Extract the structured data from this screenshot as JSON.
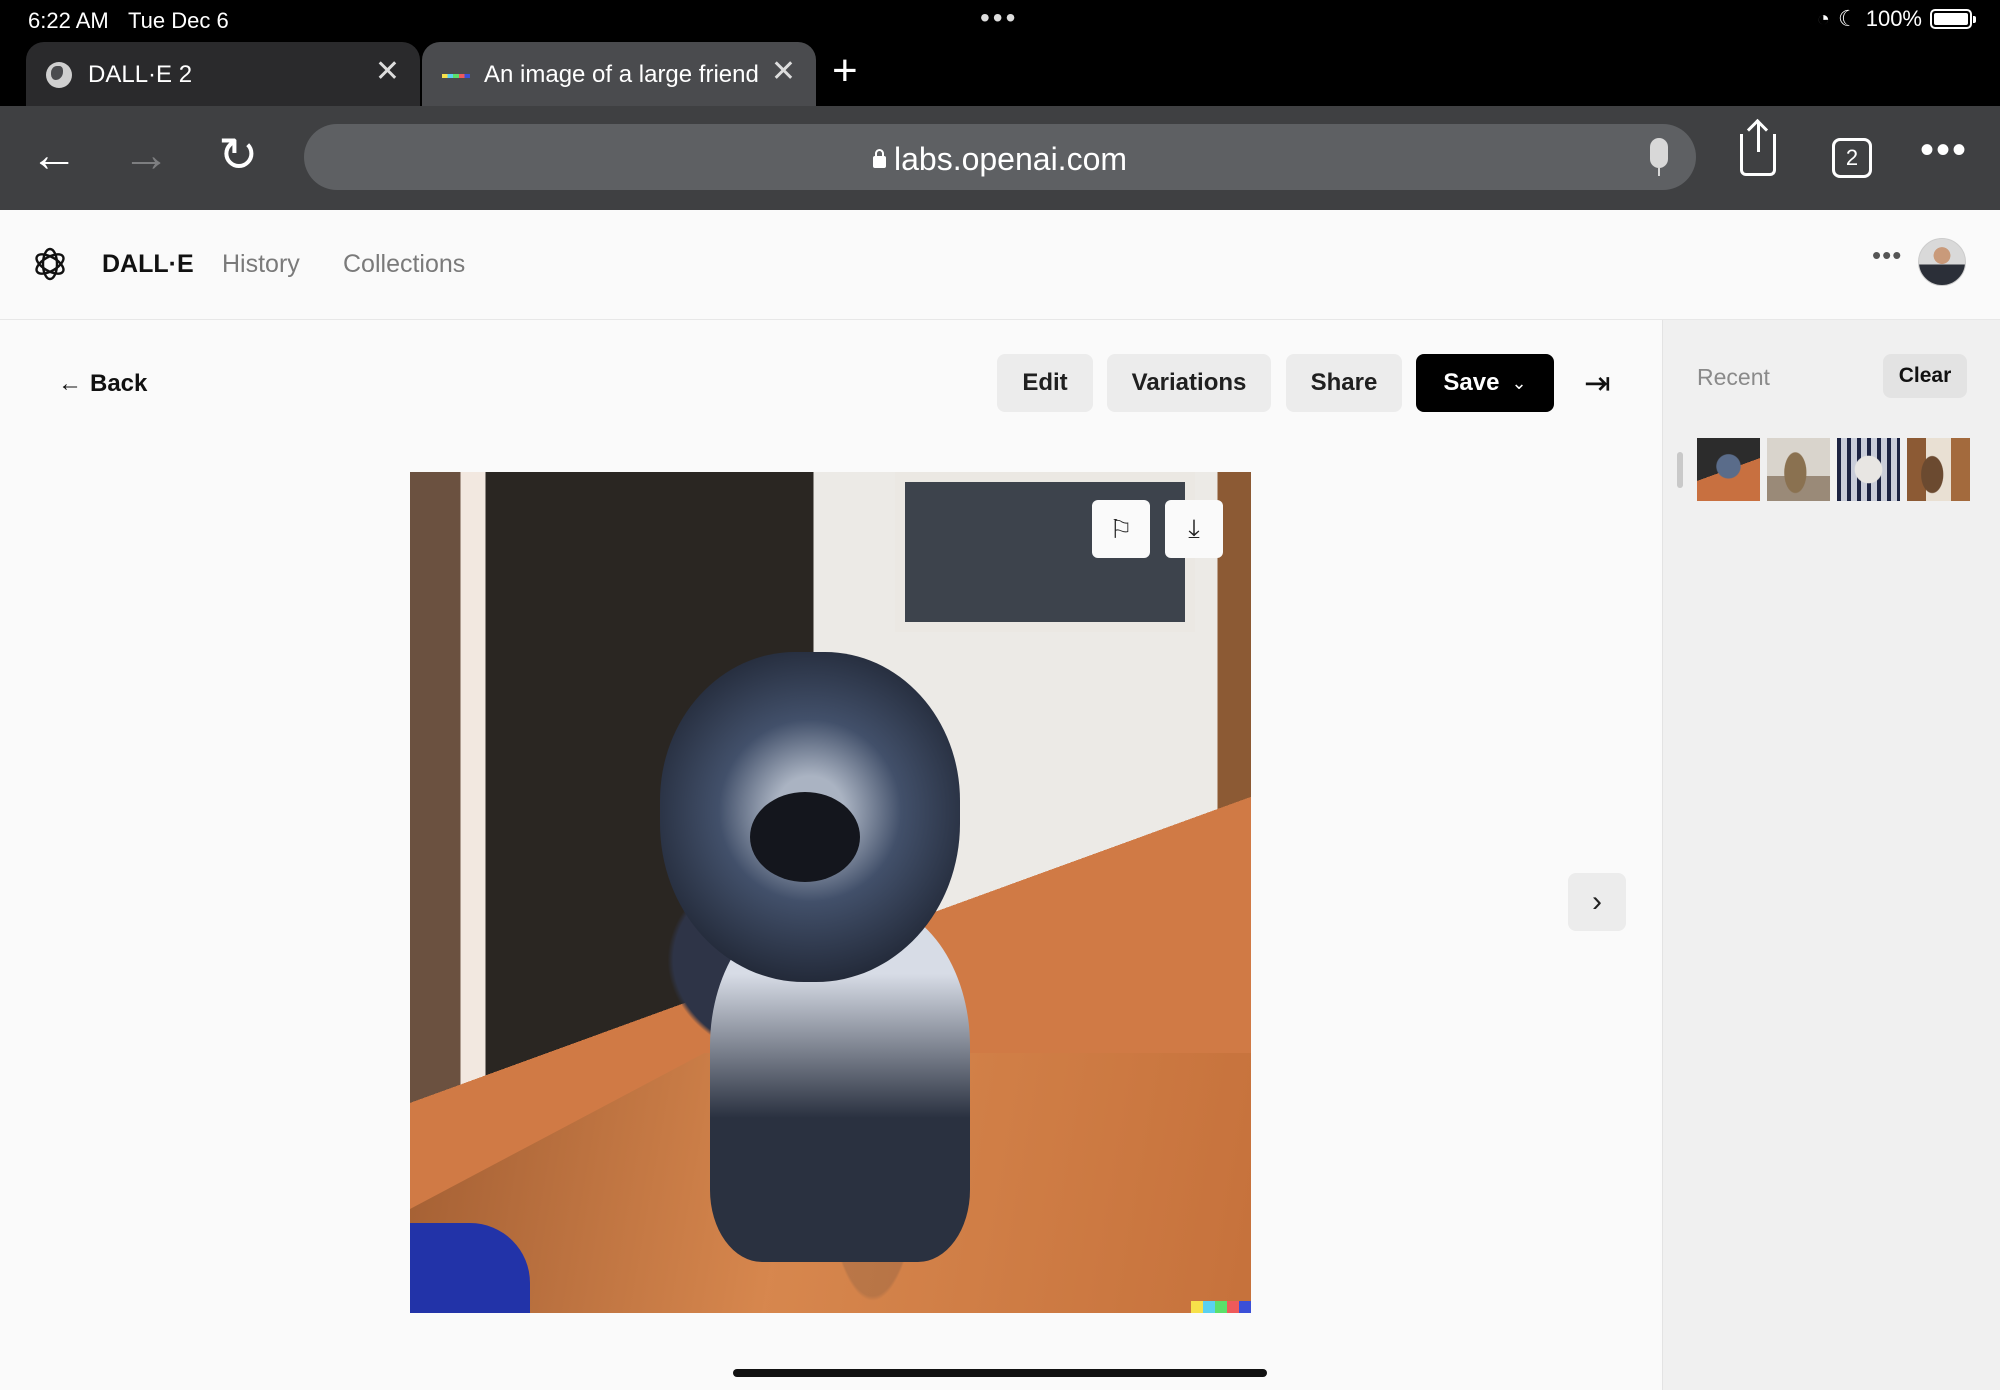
{
  "status_bar": {
    "time": "6:22 AM",
    "date": "Tue Dec 6",
    "battery": "100%"
  },
  "browser": {
    "tabs": [
      {
        "title": "DALL·E 2",
        "active": false
      },
      {
        "title": "An image of a large friend",
        "active": true
      }
    ],
    "url": "labs.openai.com",
    "tab_count": "2"
  },
  "header": {
    "brand": "DALL·E",
    "nav": [
      "History",
      "Collections"
    ]
  },
  "toolbar": {
    "back": "Back",
    "edit": "Edit",
    "variations": "Variations",
    "share": "Share",
    "save": "Save"
  },
  "sidebar": {
    "recent_label": "Recent",
    "clear": "Clear",
    "thumbnail_count": 4
  },
  "colors": {
    "brand_button": "#000000",
    "page_bg": "#fafafa",
    "toolbar_bg": "#3f4042",
    "watermark": [
      "#f7e14a",
      "#5ad1f0",
      "#5be06a",
      "#ef5a5a",
      "#3b4fd8"
    ]
  }
}
